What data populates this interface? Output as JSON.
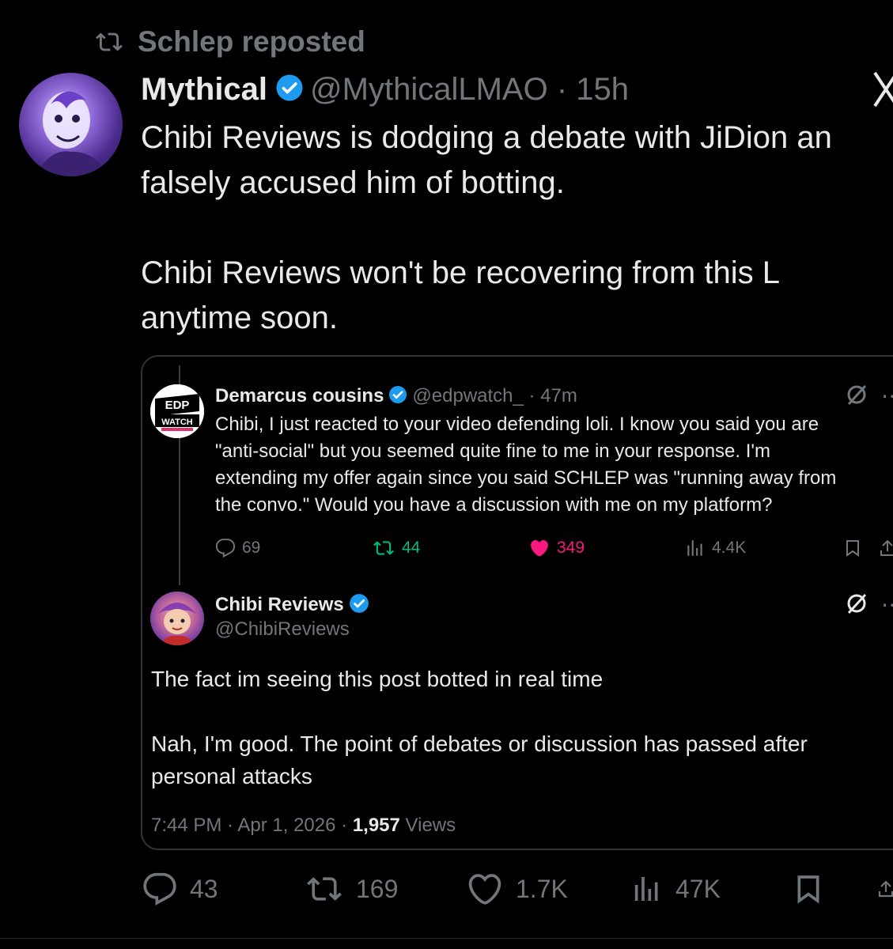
{
  "repost": {
    "label": "Schlep reposted",
    "icon": "repost-icon"
  },
  "post": {
    "author_name": "Mythical",
    "author_handle": "@MythicalLMAO · 15h",
    "verified": true,
    "text": "Chibi Reviews is dodging a debate with JiDion an\nfalsely accused him of botting.\n\nChibi Reviews won't be recovering from this L\nanytime soon.",
    "close_icon": "x-logo-icon"
  },
  "quote1": {
    "avatar_text": "EDP WATCH",
    "author_name": "Demarcus cousins",
    "author_handle": "@edpwatch_ · 47m",
    "text": "Chibi, I just reacted to your video defending loli. I know you said you are\n\"anti-social\" but you seemed quite fine to me in your response. I'm\nextending my offer again since you said SCHLEP was \"running away from\nthe convo.\" Would you have a discussion with me on my platform?",
    "replies": "69",
    "reposts": "44",
    "likes": "349",
    "views": "4.4K"
  },
  "quote2": {
    "author_name": "Chibi Reviews",
    "author_handle": "@ChibiReviews",
    "text": "The fact im seeing this post botted in real time\n\nNah, I'm good. The point of debates or discussion has passed after\npersonal attacks",
    "time": "7:44 PM · Apr 1, 2026 · ",
    "views_count": "1,957",
    "views_label": " Views"
  },
  "actions": {
    "replies": "43",
    "reposts": "169",
    "likes": "1.7K",
    "views": "47K"
  },
  "colors": {
    "background": "#000000",
    "text": "#e7e9ea",
    "muted": "#71767b",
    "verified": "#1d9bf0",
    "repost_green": "#00ba7c",
    "like_pink": "#f91880",
    "border": "#2f3336"
  }
}
